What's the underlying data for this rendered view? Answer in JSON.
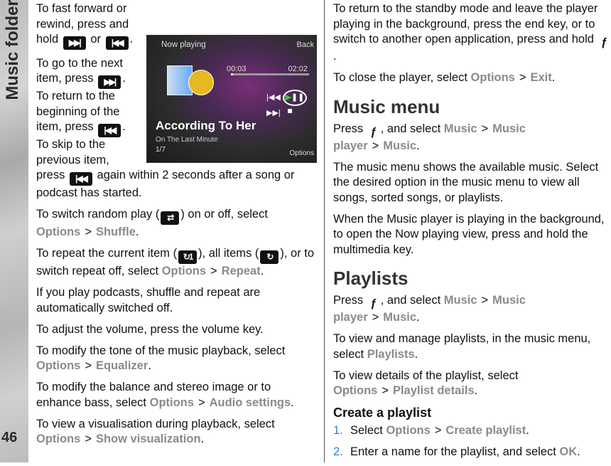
{
  "sidebar": {
    "section_title": "Music folder",
    "page_number": "46"
  },
  "phone_screen": {
    "title": "Now playing",
    "back": "Back",
    "elapsed": "00:03",
    "duration": "02:02",
    "progress_fraction": 0.03,
    "song": "According To Her",
    "album": "On The Last Minute",
    "track": "1/7",
    "options": "Options"
  },
  "colors": {
    "menu_term": "#8a8a8a",
    "list_number": "#2f7fd1",
    "heading": "#333333"
  },
  "left_column": [
    [
      {
        "t": "To fast forward or rewind, press and hold "
      },
      {
        "i": "next-icon",
        "g": "▶▶|"
      },
      {
        "t": " or "
      },
      {
        "i": "previous-icon",
        "g": "|◀◀"
      },
      {
        "t": "."
      }
    ],
    [
      {
        "t": "To go to the next item, press "
      },
      {
        "i": "next-icon",
        "g": "▶▶|"
      },
      {
        "t": ". To return to the beginning of the item, press "
      },
      {
        "i": "previous-icon",
        "g": "|◀◀"
      },
      {
        "t": ". To skip to the previous item, press "
      },
      {
        "i": "previous-icon",
        "g": "|◀◀"
      },
      {
        "t": " again within 2 seconds after a song or podcast has started."
      }
    ],
    [
      {
        "t": "To switch random play ("
      },
      {
        "i": "shuffle-icon",
        "g": "⇄",
        "sm": 1
      },
      {
        "t": ") on or off, select "
      },
      {
        "m": "Options"
      },
      {
        "s": ">"
      },
      {
        "m": "Shuffle"
      },
      {
        "t": "."
      }
    ],
    [
      {
        "t": "To repeat the current item ("
      },
      {
        "i": "repeat-one-icon",
        "g": "↻1",
        "sm": 1
      },
      {
        "t": "), all items ("
      },
      {
        "i": "repeat-all-icon",
        "g": "↻",
        "sm": 1
      },
      {
        "t": "), or to switch repeat off, select "
      },
      {
        "m": "Options"
      },
      {
        "s": ">"
      },
      {
        "m": "Repeat"
      },
      {
        "t": "."
      }
    ],
    [
      {
        "t": "If you play podcasts, shuffle and repeat are automatically switched off."
      }
    ],
    [
      {
        "t": "To adjust the volume, press the volume key."
      }
    ],
    [
      {
        "t": "To modify the tone of the music playback, select "
      },
      {
        "m": "Options"
      },
      {
        "s": ">"
      },
      {
        "m": "Equalizer"
      },
      {
        "t": "."
      }
    ],
    [
      {
        "t": "To modify the balance and stereo image or to enhance bass, select "
      },
      {
        "m": "Options"
      },
      {
        "s": ">"
      },
      {
        "m": "Audio settings"
      },
      {
        "t": "."
      }
    ],
    [
      {
        "t": "To view a visualisation during playback, select "
      },
      {
        "m": "Options"
      },
      {
        "s": ">"
      },
      {
        "m": "Show visualization"
      },
      {
        "t": "."
      }
    ]
  ],
  "right_column": [
    {
      "p": [
        {
          "t": "To return to the standby mode and leave the player playing in the background, press the end key, or to switch to another open application, press and hold "
        },
        {
          "i": "menu-key-icon",
          "g": "ƒ",
          "key": 1
        },
        {
          "t": "."
        }
      ]
    },
    {
      "p": [
        {
          "t": "To close the player, select "
        },
        {
          "m": "Options"
        },
        {
          "s": ">"
        },
        {
          "m": "Exit"
        },
        {
          "t": "."
        }
      ]
    },
    {
      "h2": "Music menu"
    },
    {
      "p": [
        {
          "t": "Press "
        },
        {
          "i": "menu-key-icon",
          "g": "ƒ",
          "key": 1
        },
        {
          "t": ", and select "
        },
        {
          "m": "Music"
        },
        {
          "s": ">"
        },
        {
          "m": "Music player"
        },
        {
          "s": ">"
        },
        {
          "m": "Music"
        },
        {
          "t": "."
        }
      ]
    },
    {
      "p": [
        {
          "t": "The music menu shows the available music. Select the desired option in the music menu to view all songs, sorted songs, or playlists."
        }
      ]
    },
    {
      "p": [
        {
          "t": "When the Music player is playing in the background, to open the Now playing view, press and hold the multimedia key."
        }
      ]
    },
    {
      "h2": "Playlists"
    },
    {
      "p": [
        {
          "t": "Press "
        },
        {
          "i": "menu-key-icon",
          "g": "ƒ",
          "key": 1
        },
        {
          "t": ", and select "
        },
        {
          "m": "Music"
        },
        {
          "s": ">"
        },
        {
          "m": "Music player"
        },
        {
          "s": ">"
        },
        {
          "m": "Music"
        },
        {
          "t": "."
        }
      ]
    },
    {
      "p": [
        {
          "t": "To view and manage playlists, in the music menu, select "
        },
        {
          "m": "Playlists"
        },
        {
          "t": "."
        }
      ]
    },
    {
      "p": [
        {
          "t": "To view details of the playlist, select "
        },
        {
          "m": "Options"
        },
        {
          "s": ">"
        },
        {
          "m": "Playlist details"
        },
        {
          "t": "."
        }
      ]
    },
    {
      "h3": "Create a playlist"
    },
    {
      "n": "1.",
      "p": [
        {
          "t": "Select "
        },
        {
          "m": "Options"
        },
        {
          "s": ">"
        },
        {
          "m": "Create playlist"
        },
        {
          "t": "."
        }
      ]
    },
    {
      "n": "2.",
      "p": [
        {
          "t": "Enter a name for the playlist, and select "
        },
        {
          "m": "OK"
        },
        {
          "t": "."
        }
      ]
    }
  ]
}
